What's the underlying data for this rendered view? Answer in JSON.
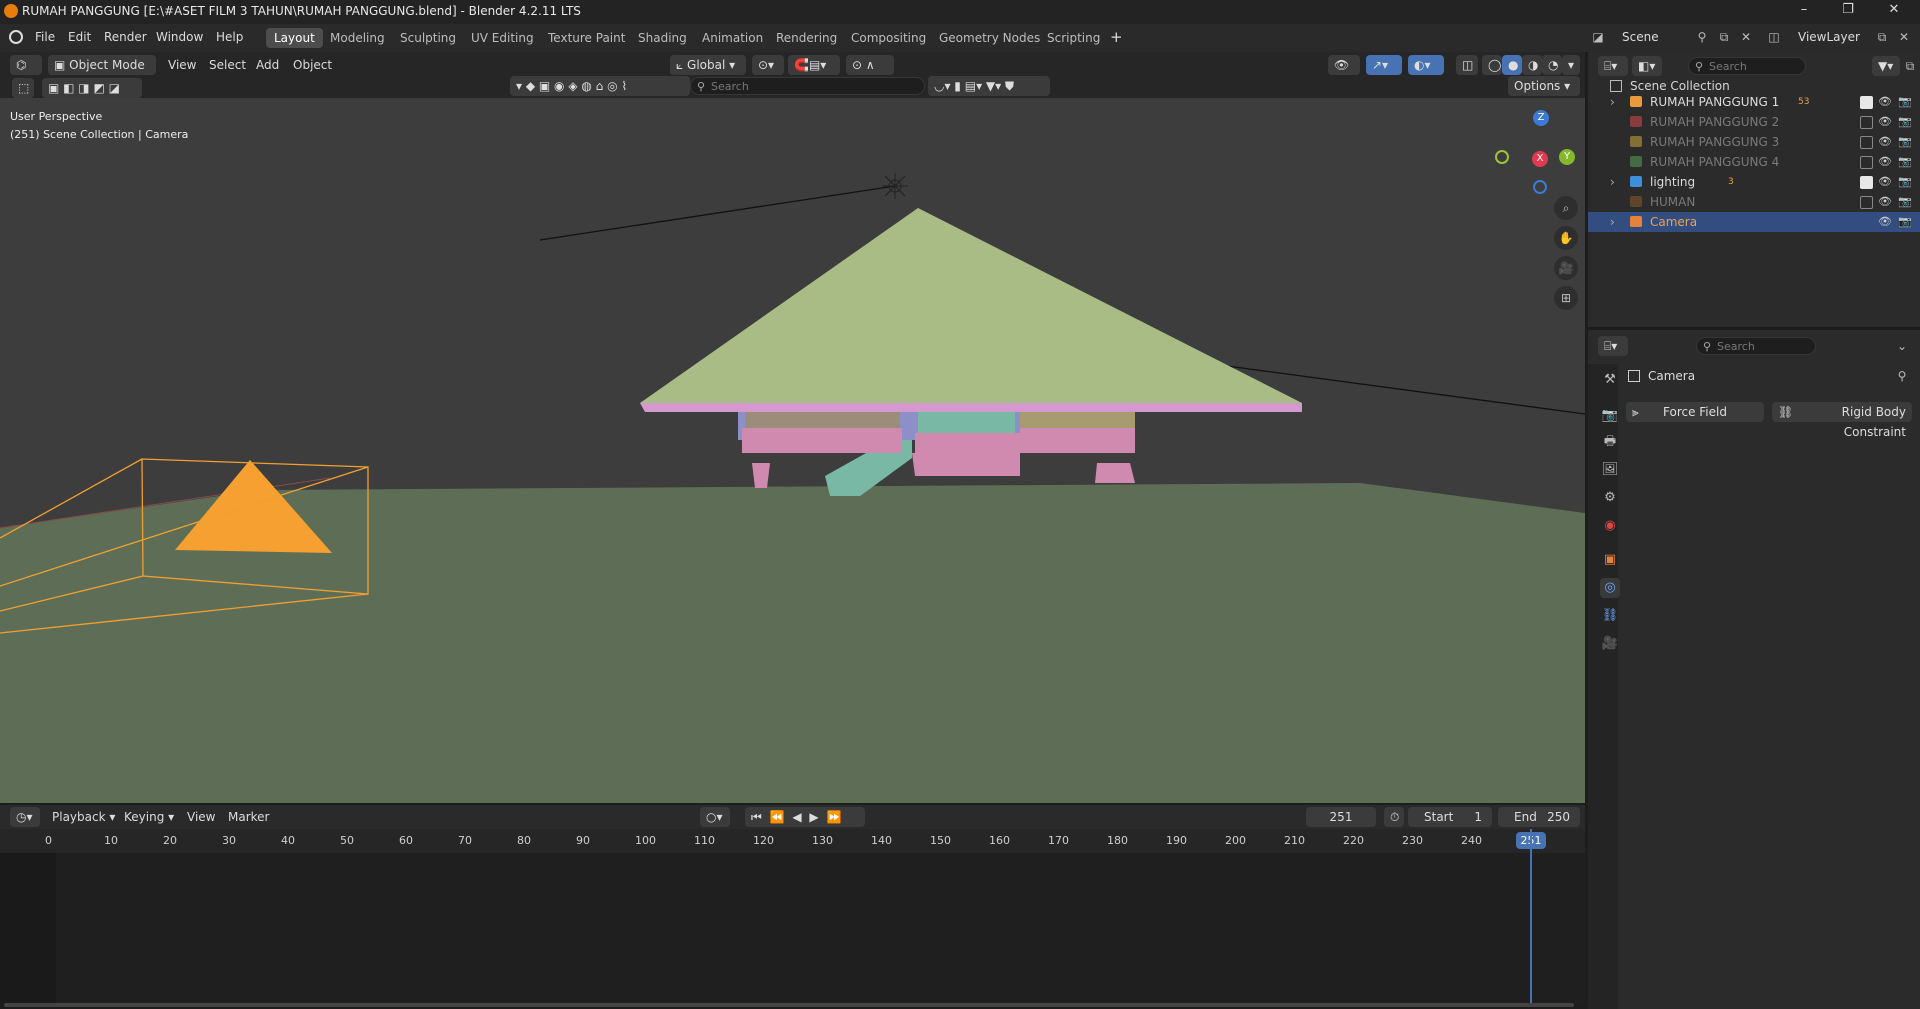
{
  "window": {
    "title": "RUMAH PANGGUNG [E:\\#ASET FILM 3 TAHUN\\RUMAH PANGGUNG.blend] - Blender 4.2.11 LTS",
    "minimize": "–",
    "maximize": "❐",
    "close": "✕"
  },
  "menus": [
    "File",
    "Edit",
    "Render",
    "Window",
    "Help"
  ],
  "workspaces": [
    "Layout",
    "Modeling",
    "Sculpting",
    "UV Editing",
    "Texture Paint",
    "Shading",
    "Animation",
    "Rendering",
    "Compositing",
    "Geometry Nodes",
    "Scripting"
  ],
  "add_workspace": "+",
  "scene_selector": {
    "scene": "Scene",
    "view_layer": "ViewLayer"
  },
  "viewport_header": {
    "mode": "Object Mode",
    "menus": [
      "View",
      "Select",
      "Add",
      "Object"
    ],
    "orientation": "Global",
    "options": "Options",
    "search_placeholder": "Search"
  },
  "viewport_overlay": {
    "perspective": "User Perspective",
    "collection_info": "(251) Scene Collection | Camera"
  },
  "gizmo": {
    "z": "Z",
    "x": "X",
    "y": "Y"
  },
  "timeline": {
    "menus": [
      "Playback",
      "Keying",
      "View",
      "Marker"
    ],
    "current_frame": "251",
    "start_label": "Start",
    "start_value": "1",
    "end_label": "End",
    "end_value": "250",
    "ruler": [
      "0",
      "10",
      "20",
      "30",
      "40",
      "50",
      "60",
      "70",
      "80",
      "90",
      "100",
      "110",
      "120",
      "130",
      "140",
      "150",
      "160",
      "170",
      "180",
      "190",
      "200",
      "210",
      "220",
      "230",
      "240"
    ],
    "playhead": "251"
  },
  "outliner": {
    "search_placeholder": "Search",
    "root": "Scene Collection",
    "items": [
      {
        "label": "RUMAH PANGGUNG 1",
        "badge": "53",
        "color": "#e89a3c",
        "enabled": true,
        "dim": false
      },
      {
        "label": "RUMAH PANGGUNG 2",
        "badge": "",
        "color": "#d64a4a",
        "enabled": false,
        "dim": true
      },
      {
        "label": "RUMAH PANGGUNG 3",
        "badge": "",
        "color": "#c9a83a",
        "enabled": false,
        "dim": true
      },
      {
        "label": "RUMAH PANGGUNG 4",
        "badge": "",
        "color": "#5aa05a",
        "enabled": false,
        "dim": true
      },
      {
        "label": "lighting",
        "badge": "3",
        "color": "#3d8fd9",
        "enabled": true,
        "dim": false
      },
      {
        "label": "HUMAN",
        "badge": "",
        "color": "#8a5a2a",
        "enabled": false,
        "dim": true
      },
      {
        "label": "Camera",
        "badge": "",
        "color": "#e8823a",
        "enabled": true,
        "dim": false,
        "selected": true
      }
    ]
  },
  "properties": {
    "search_placeholder": "Search",
    "object_name": "Camera",
    "buttons": [
      "Force Field",
      "Rigid Body Constraint"
    ]
  }
}
